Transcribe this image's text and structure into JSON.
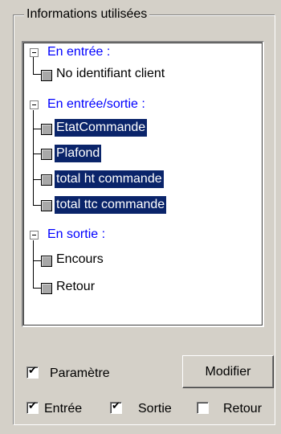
{
  "groupbox": {
    "title": "Informations utilisées"
  },
  "tree": {
    "input_label": "En entrée :",
    "input_items": [
      "No identifiant client"
    ],
    "inout_label": "En entrée/sortie :",
    "inout_items": [
      "EtatCommande",
      "Plafond",
      "total ht commande",
      "total ttc commande"
    ],
    "output_label": "En sortie :",
    "output_items": [
      "Encours",
      "Retour"
    ]
  },
  "controls": {
    "parametre": {
      "label": "Paramètre",
      "checked": true
    },
    "modifier_label": "Modifier",
    "entree": {
      "label": "Entrée",
      "checked": true
    },
    "sortie": {
      "label": "Sortie",
      "checked": true
    },
    "retour": {
      "label": "Retour",
      "checked": false
    }
  },
  "colors": {
    "selection": "#0a246a",
    "group_label": "#0000ff",
    "window_bg": "#d4d0c8"
  }
}
